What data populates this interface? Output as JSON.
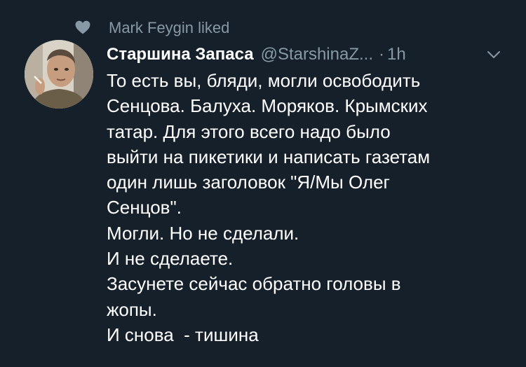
{
  "social_context": {
    "icon": "heart-icon",
    "text": "Mark Feygin liked"
  },
  "tweet": {
    "author_avatar": "avatar",
    "display_name": "Старшина Запаса",
    "handle": "@StarshinaZ...",
    "separator": "·",
    "time": "1h",
    "menu_icon": "chevron-down-icon",
    "lines": [
      "То есть вы, бляди, могли освободить",
      "Сенцова. Балуха. Моряков. Крымских",
      "татар. Для этого всего надо было",
      "выйти на пикетики и написать газетам",
      "один лишь заголовок \"Я/Мы Олег",
      "Сенцов\".",
      "Могли. Но не сделали.",
      "И не сделаете.",
      "Засунете сейчас обратно головы в",
      "жопы.",
      "И снова  - тишина"
    ]
  },
  "colors": {
    "background": "#15202b",
    "secondary_text": "#8899a6",
    "primary_text": "#ffffff"
  }
}
